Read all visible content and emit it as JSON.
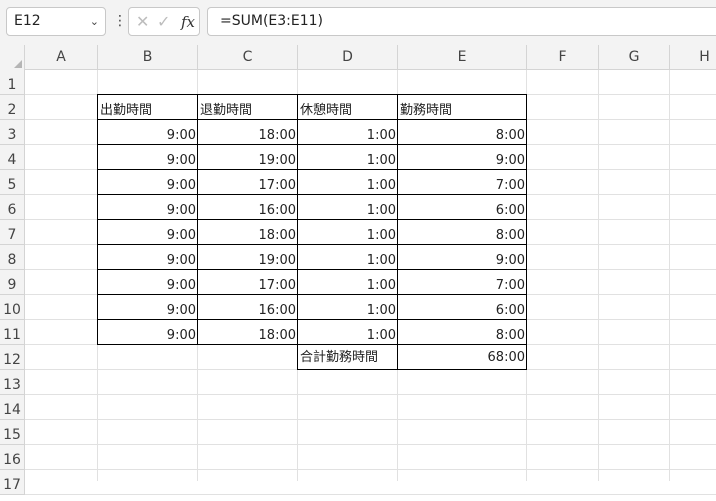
{
  "formula_bar": {
    "name_box": "E12",
    "chevron": "⌄",
    "more": "⋮",
    "cancel_icon": "✕",
    "confirm_icon": "✓",
    "fx_label": "fx",
    "formula": "=SUM(E3:E11)"
  },
  "columns": [
    "A",
    "B",
    "C",
    "D",
    "E",
    "F",
    "G",
    "H"
  ],
  "rows": [
    "1",
    "2",
    "3",
    "4",
    "5",
    "6",
    "7",
    "8",
    "9",
    "10",
    "11",
    "12",
    "13",
    "14",
    "15",
    "16",
    "17"
  ],
  "table": {
    "headers": [
      "出勤時間",
      "退勤時間",
      "休憩時間",
      "勤務時間"
    ],
    "rows": [
      [
        "9:00",
        "18:00",
        "1:00",
        "8:00"
      ],
      [
        "9:00",
        "19:00",
        "1:00",
        "9:00"
      ],
      [
        "9:00",
        "17:00",
        "1:00",
        "7:00"
      ],
      [
        "9:00",
        "16:00",
        "1:00",
        "6:00"
      ],
      [
        "9:00",
        "18:00",
        "1:00",
        "8:00"
      ],
      [
        "9:00",
        "19:00",
        "1:00",
        "9:00"
      ],
      [
        "9:00",
        "17:00",
        "1:00",
        "7:00"
      ],
      [
        "9:00",
        "16:00",
        "1:00",
        "6:00"
      ],
      [
        "9:00",
        "18:00",
        "1:00",
        "8:00"
      ]
    ],
    "total_label": "合計勤務時間",
    "total_value": "68:00"
  },
  "colors": {
    "header_bg": "#f3f3f3",
    "gridline": "#e1e1e1",
    "border": "#000000"
  }
}
